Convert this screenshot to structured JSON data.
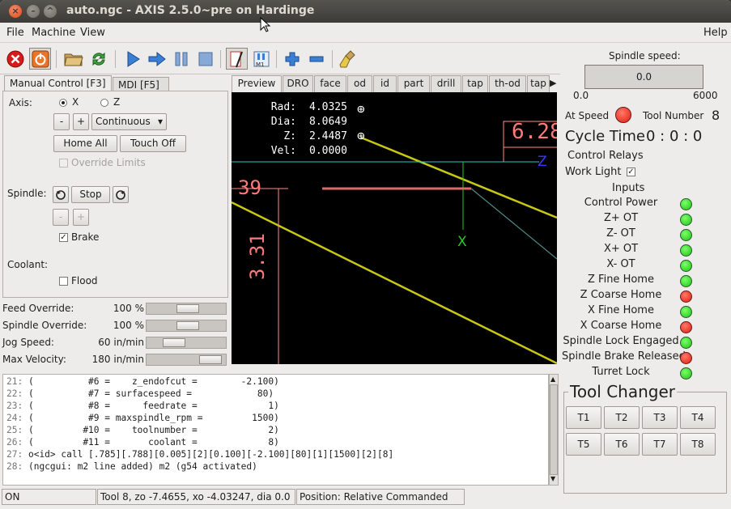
{
  "window": {
    "title": "auto.ngc - AXIS 2.5.0~pre on Hardinge"
  },
  "menu": {
    "file": "File",
    "machine": "Machine",
    "view": "View",
    "help": "Help"
  },
  "toolbar": {
    "icons": [
      "estop-icon",
      "power-icon",
      "open-file-icon",
      "reload-icon",
      "run-icon",
      "step-icon",
      "pause-icon",
      "block-delete-icon",
      "optional-stop-icon",
      "view-mode-icon",
      "zoom-in-icon",
      "zoom-out-icon",
      "clear-plot-icon"
    ]
  },
  "left": {
    "tab_manual": "Manual Control [F3]",
    "tab_mdi": "MDI [F5]",
    "axis_label": "Axis:",
    "axis_x": "X",
    "axis_z": "Z",
    "minus": "-",
    "plus": "+",
    "jog_mode": "Continuous",
    "home_all": "Home All",
    "touch_off": "Touch Off",
    "override_limits": "Override Limits",
    "spindle_label": "Spindle:",
    "stop": "Stop",
    "brake": "Brake",
    "coolant_label": "Coolant:",
    "flood": "Flood"
  },
  "overrides": [
    {
      "label": "Feed Override:",
      "value": "100 %",
      "level": 0.55
    },
    {
      "label": "Spindle Override:",
      "value": "100 %",
      "level": 0.55
    },
    {
      "label": "Jog Speed:",
      "value": "60 in/min",
      "level": 0.3
    },
    {
      "label": "Max Velocity:",
      "value": "180 in/min",
      "level": 0.95
    }
  ],
  "preview_tabs": [
    "Preview",
    "DRO",
    "face",
    "od",
    "id",
    "part",
    "drill",
    "tap",
    "th-od",
    "tap"
  ],
  "dro": [
    {
      "label": "Rad:",
      "value": "4.0325"
    },
    {
      "label": "Dia:",
      "value": "8.0649"
    },
    {
      "label": "Z:",
      "value": "2.4487"
    },
    {
      "label": "Vel:",
      "value": "0.0000"
    }
  ],
  "plot": {
    "dim_top": "6.28",
    "dim_left": "39",
    "dim_vert": "3.31",
    "axis_z": "Z",
    "axis_x": "X"
  },
  "code_lines": [
    {
      "no": "21:",
      "text": "(          #6 =    z_endofcut =        -2.100)"
    },
    {
      "no": "22:",
      "text": "(          #7 = surfacespeed =            80)"
    },
    {
      "no": "23:",
      "text": "(          #8 =      feedrate =             1)"
    },
    {
      "no": "24:",
      "text": "(          #9 = maxspindle_rpm =         1500)"
    },
    {
      "no": "25:",
      "text": "(         #10 =    toolnumber =             2)"
    },
    {
      "no": "26:",
      "text": "(         #11 =       coolant =             8)"
    },
    {
      "no": "27:",
      "text": "o<id> call [.785][.788][0.005][2][0.100][-2.100][80][1][1500][2][8]"
    },
    {
      "no": "28:",
      "text": "(ngcgui: m2 line added) m2 (g54 activated)"
    }
  ],
  "status": {
    "state": "ON",
    "tool": "Tool 8, zo -7.4655, xo -4.03247, dia 0.0",
    "position": "Position: Relative Commanded"
  },
  "right": {
    "spindle_speed_label": "Spindle speed:",
    "spindle_speed_value": "0.0",
    "scale_min": "0.0",
    "scale_max": "6000",
    "at_speed": "At Speed",
    "tool_number_label": "Tool Number",
    "tool_number": "8",
    "cycle_time_label": "Cycle Time",
    "cycle_time": "0 : 0 : 0",
    "control_relays": "Control Relays",
    "work_light": "Work Light",
    "inputs_label": "Inputs",
    "inputs": [
      {
        "label": "Control Power",
        "state": "green"
      },
      {
        "label": "Z+ OT",
        "state": "green"
      },
      {
        "label": "Z- OT",
        "state": "green"
      },
      {
        "label": "X+ OT",
        "state": "green"
      },
      {
        "label": "X- OT",
        "state": "green"
      },
      {
        "label": "Z Fine Home",
        "state": "green"
      },
      {
        "label": "Z Coarse Home",
        "state": "red"
      },
      {
        "label": "X Fine Home",
        "state": "green"
      },
      {
        "label": "X Coarse Home",
        "state": "red"
      },
      {
        "label": "Spindle Lock Engaged",
        "state": "green"
      },
      {
        "label": "Spindle Brake Released",
        "state": "red"
      },
      {
        "label": "Turret Lock",
        "state": "green"
      }
    ],
    "tool_changer_label": "Tool Changer",
    "tools": [
      "T1",
      "T2",
      "T3",
      "T4",
      "T5",
      "T6",
      "T7",
      "T8"
    ]
  }
}
